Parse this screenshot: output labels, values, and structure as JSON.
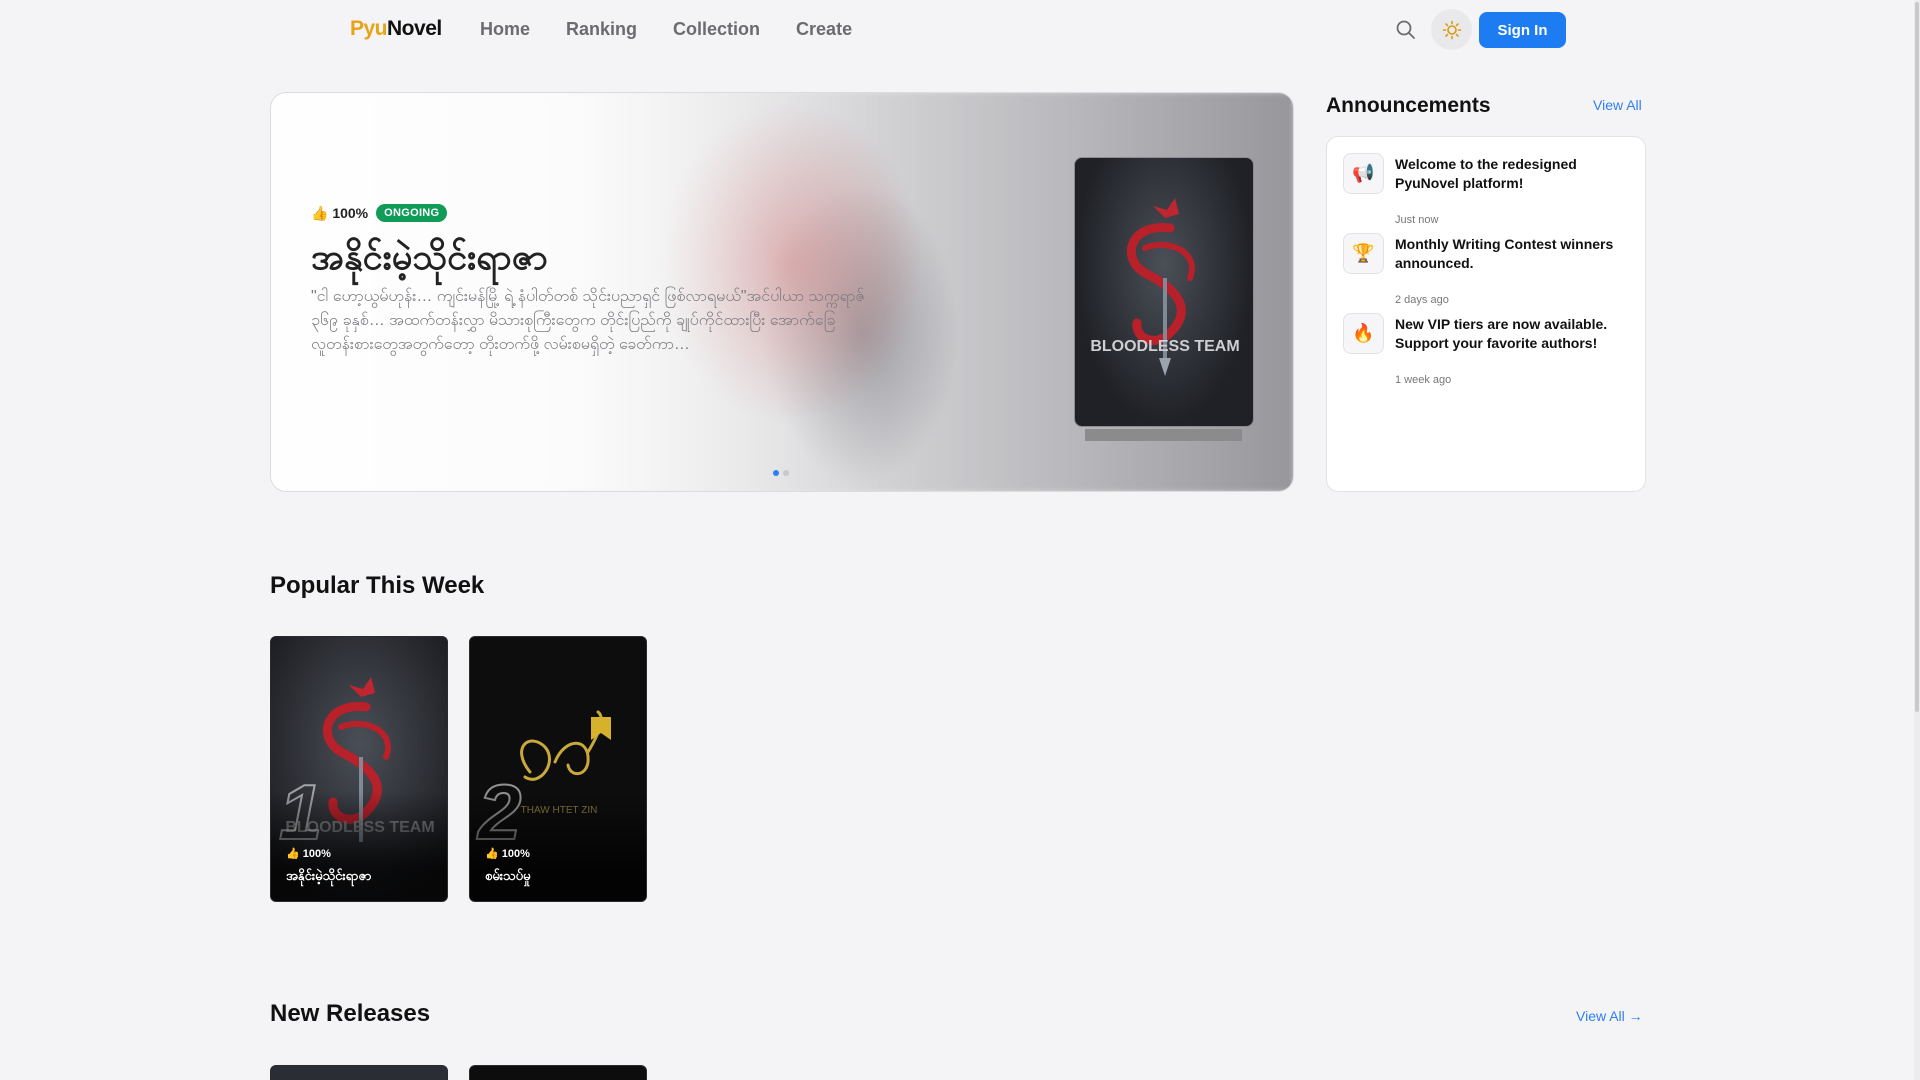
{
  "header": {
    "logo_pyu": "Pyu",
    "logo_novel": "Novel",
    "nav": [
      "Home",
      "Ranking",
      "Collection",
      "Create"
    ],
    "signin_label": "Sign In"
  },
  "hero": {
    "rating": "👍 100%",
    "status": "ONGOING",
    "title": "အနိုင်းမဲ့သိုင်းရာဇာ",
    "description": "\"ငါ ဟော့ယွမ်ဟုန်း… ကျင်းမန်မြို့ ရဲ့ နံပါတ်တစ် သိုင်းပညာရှင် ဖြစ်လာရမယ်\"အင်ပါယာ သက္ကရာဇ် ၃၆၉ ခုနှစ်… အထက်တန်းလွှာ မိသားစုကြီးတွေက တိုင်းပြည်ကို ချုပ်ကိုင်ထားပြီး အောက်ခြေလူတန်းစားတွေအတွက်တော့ တိုးတက်ဖို့ လမ်းစမရှိတဲ့ ခေတ်ကာ…",
    "cover_text": "BLOODLESS TEAM",
    "slides": 2,
    "active_slide": 1
  },
  "announcements": {
    "title": "Announcements",
    "view_all": "View All",
    "items": [
      {
        "icon": "megaphone-icon",
        "glyph": "📢",
        "text": "Welcome to the redesigned PyuNovel platform!",
        "time": "Just now"
      },
      {
        "icon": "trophy-icon",
        "glyph": "🏆",
        "text": "Monthly Writing Contest winners announced.",
        "time": "2 days ago"
      },
      {
        "icon": "fire-icon",
        "glyph": "🔥",
        "text": "New VIP tiers are now available. Support your favorite authors!",
        "time": "1 week ago"
      }
    ]
  },
  "popular": {
    "title": "Popular This Week",
    "books": [
      {
        "rank": "1",
        "rating": "👍 100%",
        "title": "အနိုင်းမဲ့သိုင်းရာဇာ",
        "cover_text": "BLOODLESS TEAM"
      },
      {
        "rank": "2",
        "rating": "👍 100%",
        "title": "စမ်းသပ်မှု",
        "cover_text": "THAW HTET ZIN"
      }
    ]
  },
  "new_releases": {
    "title": "New Releases",
    "view_all": "View All →"
  },
  "colors": {
    "accent": "#1d7cf2",
    "brand_yellow": "#e8a317",
    "ongoing_green": "#0f9c58"
  }
}
